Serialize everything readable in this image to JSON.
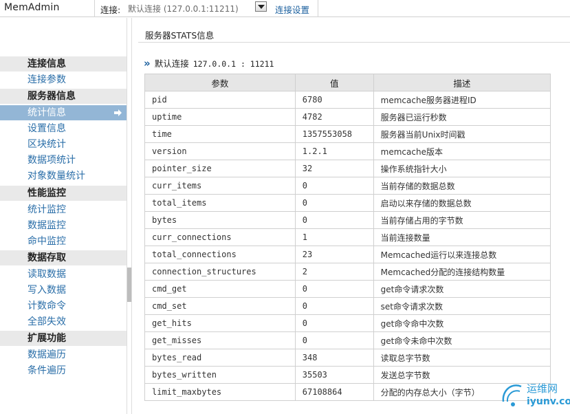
{
  "app": {
    "brand": "MemAdmin"
  },
  "topbar": {
    "conn_label": "连接:",
    "conn_selected": "默认连接 (127.0.0.1:11211)",
    "conn_settings": "连接设置"
  },
  "sidebar": {
    "sections": [
      {
        "header": "连接信息",
        "items": [
          "连接参数"
        ]
      },
      {
        "header": "服务器信息",
        "items": [
          "统计信息",
          "设置信息",
          "区块统计",
          "数据项统计",
          "对象数量统计"
        ]
      },
      {
        "header": "性能监控",
        "items": [
          "统计监控",
          "数据监控",
          "命中监控"
        ]
      },
      {
        "header": "数据存取",
        "items": [
          "读取数据",
          "写入数据",
          "计数命令",
          "全部失效"
        ]
      },
      {
        "header": "扩展功能",
        "items": [
          "数据遍历",
          "条件遍历"
        ]
      }
    ],
    "active_item": "统计信息"
  },
  "main": {
    "title": "服务器STATS信息",
    "conn_name": "默认连接",
    "conn_addr": "127.0.0.1 : 11211",
    "table": {
      "headers": [
        "参数",
        "值",
        "描述"
      ],
      "rows": [
        [
          "pid",
          "6780",
          "memcache服务器进程ID"
        ],
        [
          "uptime",
          "4782",
          "服务器已运行秒数"
        ],
        [
          "time",
          "1357553058",
          "服务器当前Unix时间戳"
        ],
        [
          "version",
          "1.2.1",
          "memcache版本"
        ],
        [
          "pointer_size",
          "32",
          "操作系统指针大小"
        ],
        [
          "curr_items",
          "0",
          "当前存储的数据总数"
        ],
        [
          "total_items",
          "0",
          "启动以来存储的数据总数"
        ],
        [
          "bytes",
          "0",
          "当前存储占用的字节数"
        ],
        [
          "curr_connections",
          "1",
          "当前连接数量"
        ],
        [
          "total_connections",
          "23",
          "Memcached运行以来连接总数"
        ],
        [
          "connection_structures",
          "2",
          "Memcached分配的连接结构数量"
        ],
        [
          "cmd_get",
          "0",
          "get命令请求次数"
        ],
        [
          "cmd_set",
          "0",
          "set命令请求次数"
        ],
        [
          "get_hits",
          "0",
          "get命令命中次数"
        ],
        [
          "get_misses",
          "0",
          "get命令未命中次数"
        ],
        [
          "bytes_read",
          "348",
          "读取总字节数"
        ],
        [
          "bytes_written",
          "35503",
          "发送总字节数"
        ],
        [
          "limit_maxbytes",
          "67108864",
          "分配的内存总大小（字节）"
        ]
      ]
    }
  },
  "watermark": {
    "name": "运维网",
    "url": "iyunv.com"
  },
  "colors": {
    "link": "#2a6ea8",
    "active_bg": "#93b6d6",
    "header_bg": "#e9e9e9"
  },
  "icons": {
    "active_arrow": "arrow-right-icon",
    "conn_marker": "double-chevron-icon",
    "dropdown": "triangle-down-icon"
  }
}
